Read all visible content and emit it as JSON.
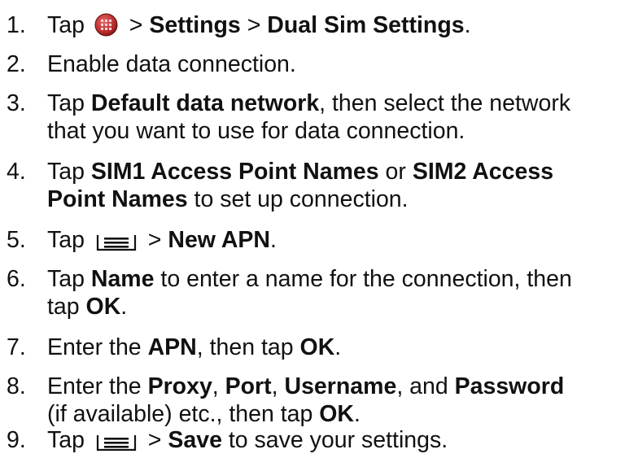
{
  "steps": [
    {
      "number": "1.",
      "icon": "apps-grid-icon",
      "parts": [
        "Tap ",
        " > ",
        "Settings",
        " > ",
        "Dual Sim Settings",
        "."
      ]
    },
    {
      "number": "2.",
      "parts": [
        "Enable data connection."
      ]
    },
    {
      "number": "3.",
      "parts": [
        "Tap ",
        "Default data network",
        ", then select the network",
        "that you want to use for data connection."
      ]
    },
    {
      "number": "4.",
      "parts": [
        "Tap ",
        "SIM1 Access Point Names",
        " or ",
        "SIM2 Access",
        "Point Names",
        " to set up connection."
      ]
    },
    {
      "number": "5.",
      "icon": "menu-key-icon",
      "parts": [
        "Tap ",
        " > ",
        "New APN",
        "."
      ]
    },
    {
      "number": "6.",
      "parts": [
        "Tap ",
        "Name",
        " to enter a name for the connection, then",
        "tap ",
        "OK",
        "."
      ]
    },
    {
      "number": "7.",
      "parts": [
        "Enter the ",
        "APN",
        ", then tap ",
        "OK",
        "."
      ]
    },
    {
      "number": "8.",
      "parts": [
        "Enter the ",
        "Proxy",
        ", ",
        "Port",
        ", ",
        "Username",
        ", and ",
        "Password",
        "(if available) etc., then tap ",
        "OK",
        "."
      ]
    },
    {
      "number": "9.",
      "icon": "menu-key-icon",
      "parts": [
        "Tap ",
        " > ",
        "Save",
        " to save your settings."
      ]
    }
  ],
  "colors": {
    "text": "#111111",
    "apps_icon_ring": "#8b1a1a",
    "apps_icon_fill": "#c23b3b",
    "menu_icon": "#111111"
  }
}
